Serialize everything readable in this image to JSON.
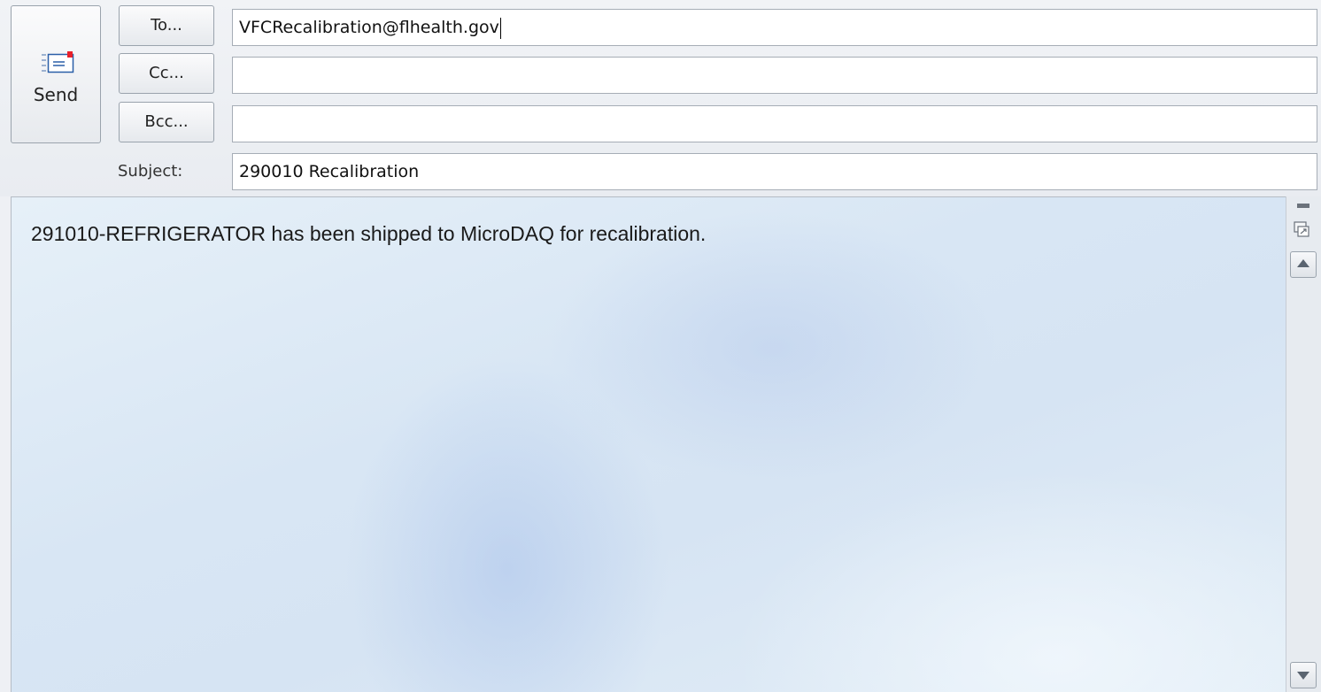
{
  "compose": {
    "send_label": "Send",
    "to_label": "To...",
    "cc_label": "Cc...",
    "bcc_label": "Bcc...",
    "subject_label": "Subject:",
    "to_value": "VFCRecalibration@flhealth.gov",
    "cc_value": "",
    "bcc_value": "",
    "subject_value": "290010 Recalibration",
    "body_text": "291010-REFRIGERATOR has been shipped to MicroDAQ for recalibration."
  },
  "icons": {
    "send": "envelope-send-icon",
    "expand": "expand-icon",
    "scroll_up": "scroll-up-icon",
    "scroll_down": "scroll-down-icon"
  },
  "colors": {
    "accent_red": "#e8202a",
    "envelope_blue": "#2a5fa8"
  }
}
